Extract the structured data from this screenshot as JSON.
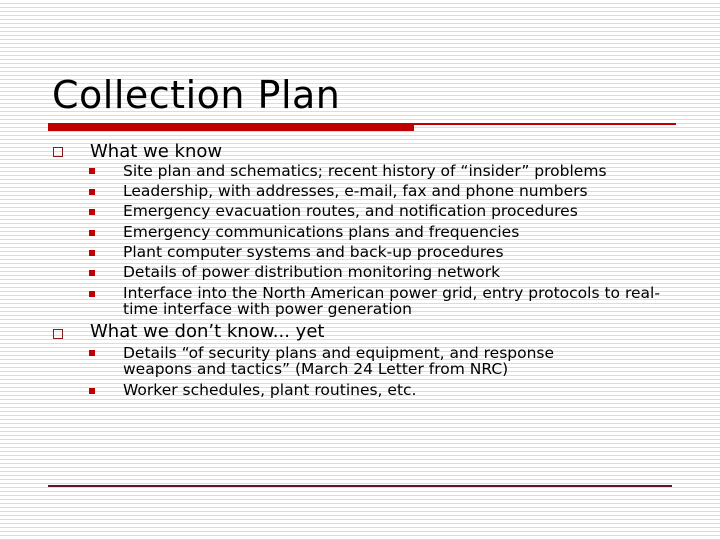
{
  "slide": {
    "title": "Collection Plan",
    "sections": [
      {
        "heading": "What we know",
        "items": [
          "Site plan and schematics; recent history of “insider” problems",
          "Leadership, with addresses, e-mail, fax and phone numbers",
          "Emergency evacuation routes, and notification procedures",
          "Emergency communications plans and frequencies",
          "Plant computer systems and back-up procedures",
          "Details of power distribution monitoring network",
          "Interface into the North American power grid, entry protocols to real-time interface with power generation"
        ]
      },
      {
        "heading": "What we don’t know... yet",
        "items": [
          "Details “of security plans and equipment, and response weapons and tactics”  (March 24 Letter from NRC)",
          "Worker schedules, plant routines, etc."
        ]
      }
    ],
    "accent_color": "#c00000"
  }
}
